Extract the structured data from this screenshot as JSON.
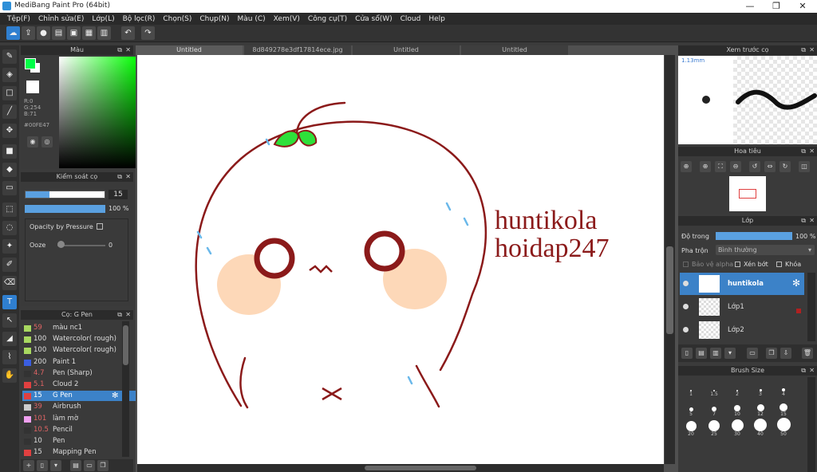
{
  "window": {
    "title": "MediBang Paint Pro (64bit)",
    "minimize": "—",
    "maximize": "❐",
    "close": "✕"
  },
  "menu": [
    "Tệp(F)",
    "Chỉnh sửa(E)",
    "Lớp(L)",
    "Bộ lọc(R)",
    "Chọn(S)",
    "Chụp(N)",
    "Màu (C)",
    "Xem(V)",
    "Công cụ(T)",
    "Cửa sổ(W)",
    "Cloud",
    "Help"
  ],
  "toolbar": {
    "undo": "↶",
    "redo": "↷"
  },
  "color_panel": {
    "title": "Màu",
    "r": "R:0",
    "g": "G:254",
    "b": "B:71",
    "hex": "#00FE47",
    "fg": "#00fe47",
    "bg": "#ffffff"
  },
  "brush_control": {
    "title": "Kiểm soát cọ",
    "size": "15",
    "opacity": "100 %",
    "opacity_by_pressure": "Opacity by Pressure",
    "ooze_label": "Ooze",
    "ooze_value": "0"
  },
  "brush_list": {
    "title": "Cọ: G Pen",
    "items": [
      {
        "size": "59",
        "name": "màu nc1",
        "color": "#a8d860",
        "size_color": "#e06464"
      },
      {
        "size": "100",
        "name": "Watercolor( rough)",
        "color": "#a8d860",
        "size_color": "#dddddd"
      },
      {
        "size": "100",
        "name": "Watercolor( rough)",
        "color": "#a8d860",
        "size_color": "#dddddd"
      },
      {
        "size": "200",
        "name": "Paint 1",
        "color": "#3a5ee0",
        "size_color": "#dddddd"
      },
      {
        "size": "4.7",
        "name": "Pen (Sharp)",
        "color": "#333333",
        "size_color": "#e06464"
      },
      {
        "size": "5.1",
        "name": "Cloud 2",
        "color": "#e04040",
        "size_color": "#e06464"
      },
      {
        "size": "15",
        "name": "G Pen",
        "color": "#e04040",
        "size_color": "#e06464"
      },
      {
        "size": "39",
        "name": "Airbrush",
        "color": "#cccccc",
        "size_color": "#e06464"
      },
      {
        "size": "101",
        "name": "làm mờ",
        "color": "#f0a0f0",
        "size_color": "#e06464"
      },
      {
        "size": "10.5",
        "name": "Pencil",
        "color": "#333333",
        "size_color": "#e06464"
      },
      {
        "size": "10",
        "name": "Pen",
        "color": "#333333",
        "size_color": "#dddddd"
      },
      {
        "size": "15",
        "name": "Mapping Pen",
        "color": "#e04040",
        "size_color": "#dddddd"
      }
    ],
    "selected": 6
  },
  "tabs": [
    "Untitled",
    "8d849278e3df17814ece.jpg",
    "Untitled",
    "Untitled"
  ],
  "canvas_text": {
    "line1": "huntikola",
    "line2": "hoidap247",
    "color": "#8b1a1a"
  },
  "preview": {
    "title": "Xem trước cọ",
    "size_label": "1.13mm"
  },
  "navigator": {
    "title": "Hoa tiêu"
  },
  "layers": {
    "title": "Lớp",
    "opacity_label": "Độ trong",
    "opacity_value": "100 %",
    "blend_label": "Pha trộn",
    "blend_value": "Bình thường",
    "protect_alpha": "Bảo vệ alpha",
    "clipping": "Xén bớt",
    "lock": "Khóa",
    "items": [
      {
        "name": "huntikola"
      },
      {
        "name": "Lớp1"
      },
      {
        "name": "Lớp2"
      }
    ]
  },
  "brush_size": {
    "title": "Brush Size",
    "labels": [
      "1",
      "1.5",
      "2",
      "3",
      "4",
      "5",
      "7",
      "10",
      "12",
      "15",
      "20",
      "25",
      "30",
      "40",
      "50"
    ]
  }
}
